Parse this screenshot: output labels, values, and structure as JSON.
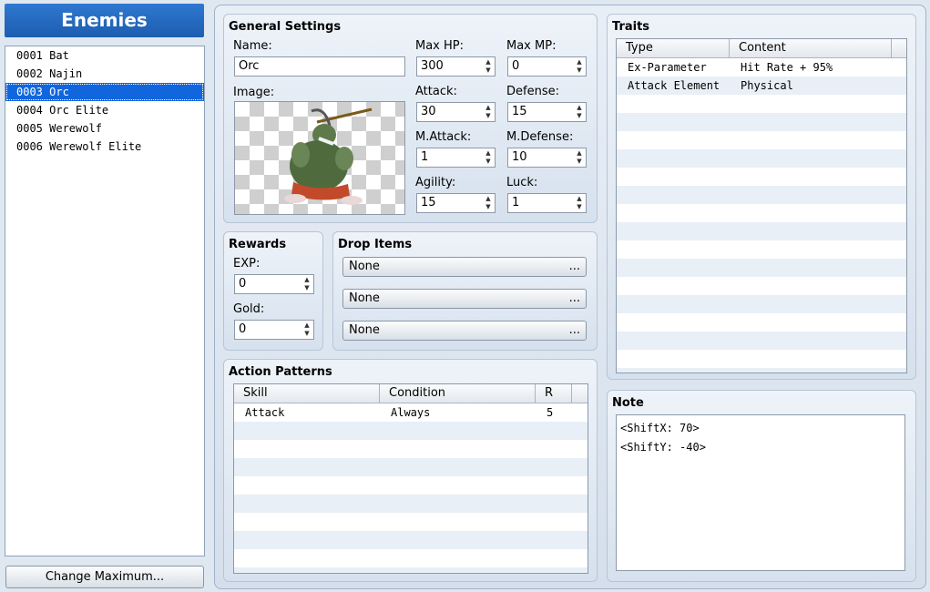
{
  "left": {
    "title": "Enemies",
    "enemies": [
      "0001 Bat",
      "0002 Najin",
      "0003 Orc",
      "0004 Orc Elite",
      "0005 Werewolf",
      "0006 Werewolf Elite"
    ],
    "selected_index": 2,
    "change_max_label": "Change Maximum..."
  },
  "general": {
    "title": "General Settings",
    "name_label": "Name:",
    "name_value": "Orc",
    "image_label": "Image:",
    "max_hp_label": "Max HP:",
    "max_hp": "300",
    "max_mp_label": "Max MP:",
    "max_mp": "0",
    "attack_label": "Attack:",
    "attack": "30",
    "defense_label": "Defense:",
    "defense": "15",
    "mattack_label": "M.Attack:",
    "mattack": "1",
    "mdefense_label": "M.Defense:",
    "mdefense": "10",
    "agility_label": "Agility:",
    "agility": "15",
    "luck_label": "Luck:",
    "luck": "1"
  },
  "rewards": {
    "title": "Rewards",
    "exp_label": "EXP:",
    "exp": "0",
    "gold_label": "Gold:",
    "gold": "0"
  },
  "drops": {
    "title": "Drop Items",
    "items": [
      "None",
      "None",
      "None"
    ],
    "ellipsis": "..."
  },
  "actions": {
    "title": "Action Patterns",
    "columns": [
      "Skill",
      "Condition",
      "R"
    ],
    "rows": [
      {
        "skill": "Attack",
        "condition": "Always",
        "r": "5"
      }
    ]
  },
  "traits": {
    "title": "Traits",
    "columns": [
      "Type",
      "Content"
    ],
    "rows": [
      {
        "type": "Ex-Parameter",
        "content": "Hit Rate + 95%"
      },
      {
        "type": "Attack Element",
        "content": "Physical"
      }
    ]
  },
  "note": {
    "title": "Note",
    "lines": [
      "<ShiftX: 70>",
      "<ShiftY: -40>"
    ]
  },
  "colors": {
    "accent": "#1166dd",
    "title_bar": "#1c5db0"
  }
}
